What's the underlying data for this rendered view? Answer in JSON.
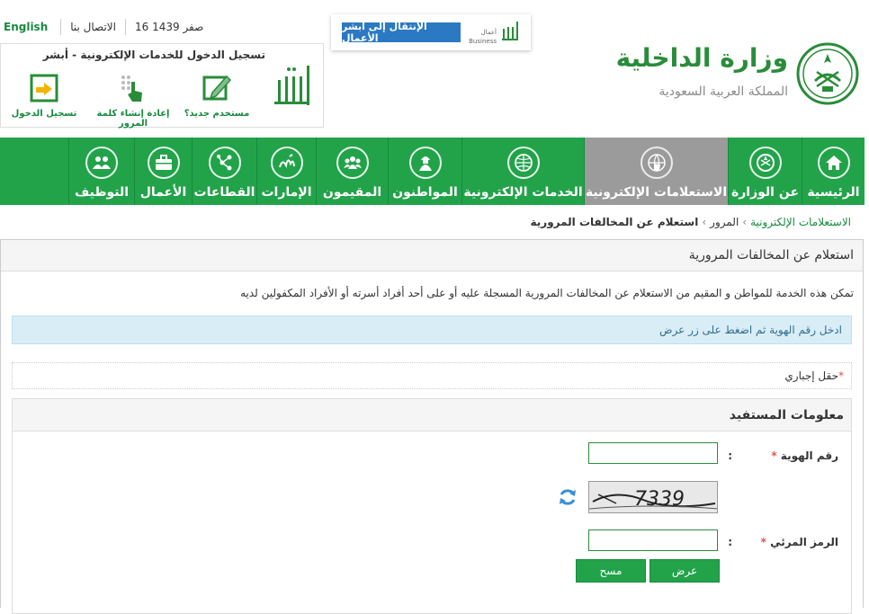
{
  "util": {
    "english": "English",
    "contact": "الاتصال بنا",
    "date": "16 صفر 1439"
  },
  "login": {
    "title": "تسجيل الدخول للخدمات الإلكترونية - أبشر",
    "new_user": "مستخدم جديد؟",
    "reset_password": "إعادة إنشاء كلمة المرور",
    "sign_in": "تسجيل الدخول"
  },
  "business": {
    "button": "الإنتقال إلى أبشر الأعمال",
    "logo_small": "أعمال",
    "logo_en": "Business"
  },
  "ministry": {
    "name": "وزارة الداخلية",
    "subtitle": "المملكة العربية السعودية"
  },
  "nav": {
    "items": [
      {
        "label": "الرئيسية",
        "icon": "home-icon"
      },
      {
        "label": "عن الوزارة",
        "icon": "emblem-icon"
      },
      {
        "label": "الاستعلامات الإلكترونية",
        "icon": "globe-hand-icon",
        "active": true
      },
      {
        "label": "الخدمات الإلكترونية",
        "icon": "globe-icon"
      },
      {
        "label": "المواطنون",
        "icon": "citizen-icon"
      },
      {
        "label": "المقيمون",
        "icon": "residents-icon"
      },
      {
        "label": "الإمارات",
        "icon": "emirates-icon"
      },
      {
        "label": "القطاعات",
        "icon": "sectors-icon"
      },
      {
        "label": "الأعمال",
        "icon": "briefcase-icon"
      },
      {
        "label": "التوظيف",
        "icon": "employment-icon"
      }
    ]
  },
  "breadcrumb": {
    "root": "الاستعلامات الإلكترونية",
    "section": "المرور",
    "current": "استعلام عن المخالفات المرورية"
  },
  "page": {
    "title": "استعلام عن المخالفات المرورية",
    "description": "تمكن هذه الخدمة للمواطن و المقيم من الاستعلام عن المخالفات المرورية المسجلة عليه أو على أحد أفراد أسرته أو الأفراد المكفولين لديه",
    "info": "ادخل رقم الهوية ثم اضغط على زر عرض",
    "required_star": "*",
    "required_note": "حقل إجباري"
  },
  "form": {
    "section_title": "معلومات المستفيد",
    "id_label": "رقم الهوية",
    "code_label": "الرمز المرئي",
    "colon": ":",
    "id_value": "",
    "code_value": "",
    "captcha_text": "7339",
    "show_button": "عرض",
    "clear_button": "مسح"
  },
  "colors": {
    "green": "#22a34a",
    "dark_green": "#168a3e",
    "active_nav": "#9b9b9b",
    "info_bg": "#d9edf7",
    "info_text": "#31708f",
    "blue_button": "#2b79c2"
  }
}
